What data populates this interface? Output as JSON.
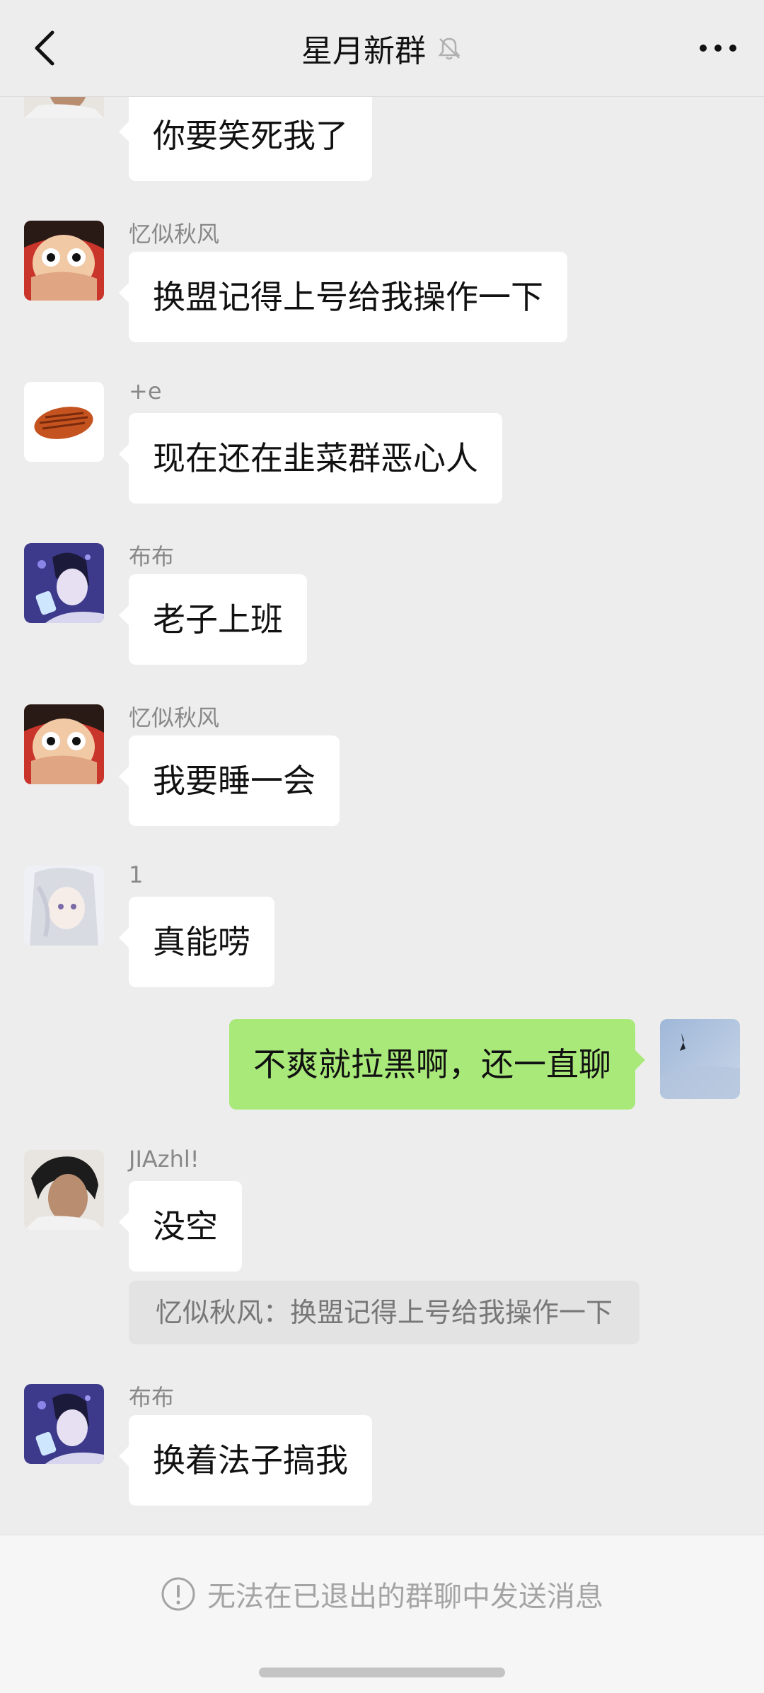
{
  "header": {
    "title": "星月新群",
    "back_icon": "chevron-left-icon",
    "mute_icon": "bell-off-icon",
    "more_icon": "more-dots-icon"
  },
  "messages": [
    {
      "sender": "",
      "text": "你要笑死我了",
      "avatar": "portrait-dark-hair-avatar"
    },
    {
      "sender": "忆似秋风",
      "text": "换盟记得上号给我操作一下",
      "avatar": "anime-pirate-avatar"
    },
    {
      "sender": "+e",
      "text": "现在还在韭菜群恶心人",
      "avatar": "grilled-meat-avatar"
    },
    {
      "sender": "布布",
      "text": "老子上班",
      "avatar": "anime-boy-phone-avatar"
    },
    {
      "sender": "忆似秋风",
      "text": "我要睡一会",
      "avatar": "anime-pirate-avatar"
    },
    {
      "sender": "1",
      "text": "真能唠",
      "avatar": "anime-white-hair-girl-avatar"
    },
    {
      "sender": "",
      "text": "不爽就拉黑啊，还一直聊",
      "avatar": "sky-photo-avatar",
      "self": true
    },
    {
      "sender": "JIAzhl!",
      "text": "没空",
      "avatar": "portrait-dark-hair-avatar",
      "quote": "忆似秋风：换盟记得上号给我操作一下"
    },
    {
      "sender": "布布",
      "text": "换着法子搞我",
      "avatar": "anime-boy-phone-avatar"
    }
  ],
  "footer": {
    "notice": "无法在已退出的群聊中发送消息",
    "notice_icon": "info-circle-icon"
  },
  "colors": {
    "background": "#ededed",
    "bubble_other": "#ffffff",
    "bubble_self": "#a9e97a",
    "quote_bg": "#e3e3e3"
  }
}
